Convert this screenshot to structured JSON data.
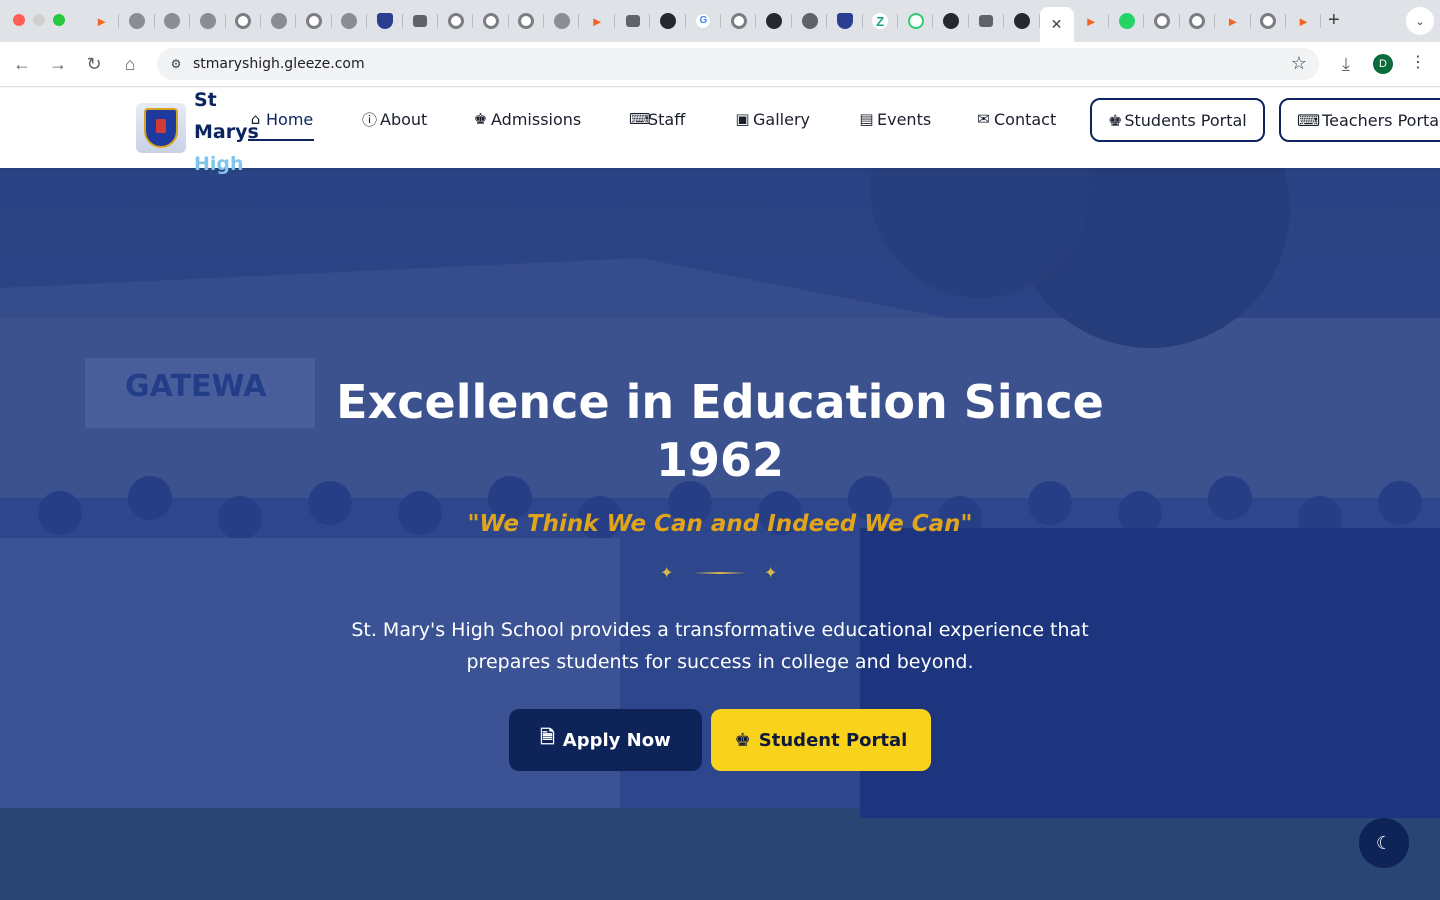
{
  "browser": {
    "tabs": [
      {
        "icon": "orange-logo-icon"
      },
      {
        "icon": "globe-icon"
      },
      {
        "icon": "globe-icon"
      },
      {
        "icon": "puzzle-icon"
      },
      {
        "icon": "ring-icon"
      },
      {
        "icon": "crest-icon"
      },
      {
        "icon": "ring-icon"
      },
      {
        "icon": "github-icon"
      },
      {
        "icon": "shield-icon"
      },
      {
        "icon": "folder-icon"
      },
      {
        "icon": "ring-icon"
      },
      {
        "icon": "ring-icon"
      },
      {
        "icon": "ring-icon"
      },
      {
        "icon": "github-icon"
      },
      {
        "icon": "ring-icon"
      },
      {
        "icon": "folder-icon"
      },
      {
        "icon": "github-icon"
      },
      {
        "icon": "google-icon"
      },
      {
        "icon": "ring-icon"
      },
      {
        "icon": "globe-icon"
      },
      {
        "icon": "chrome-icon"
      },
      {
        "icon": "shield-icon"
      },
      {
        "icon": "zed-icon"
      },
      {
        "icon": "zed-icon"
      },
      {
        "icon": "globe-icon"
      },
      {
        "icon": "folder-icon"
      },
      {
        "icon": "github-icon"
      }
    ],
    "active_tab_close": "✕",
    "tabs_after": [
      {
        "icon": "orange-logo-icon"
      },
      {
        "icon": "whatsapp-icon"
      },
      {
        "icon": "ring-icon"
      },
      {
        "icon": "ring-icon"
      },
      {
        "icon": "orange-logo-icon"
      },
      {
        "icon": "ring-icon"
      },
      {
        "icon": "orange-logo-icon"
      }
    ],
    "url": "stmaryshigh.gleeze.com",
    "profile_initial": "D"
  },
  "site": {
    "brand_line1": "St",
    "brand_line2": "Marys",
    "brand_line3": "High",
    "nav": [
      {
        "label": "Home",
        "icon": "home-icon",
        "active": true
      },
      {
        "label": "About",
        "icon": "info-icon"
      },
      {
        "label": "Admissions",
        "icon": "graduate-icon"
      },
      {
        "label": "Staff",
        "icon": "teacher-icon"
      },
      {
        "label": "Gallery",
        "icon": "gallery-icon"
      },
      {
        "label": "Events",
        "icon": "newspaper-icon"
      },
      {
        "label": "Contact",
        "icon": "envelope-icon"
      }
    ],
    "students_portal": "Students Portal",
    "teachers_portal": "Teachers Portal"
  },
  "hero": {
    "title": "Excellence in Education Since 1962",
    "motto": "\"We Think We Can and Indeed We Can\"",
    "description": "St. Mary's High School provides a transformative educational experience that prepares students for success in college and beyond.",
    "apply_label": "Apply Now",
    "portal_label": "Student Portal"
  },
  "colors": {
    "navy": "#0c2560",
    "gold": "#e2a51a",
    "yellow_button": "#f9d21c",
    "hero_overlay": "#1c3787"
  }
}
